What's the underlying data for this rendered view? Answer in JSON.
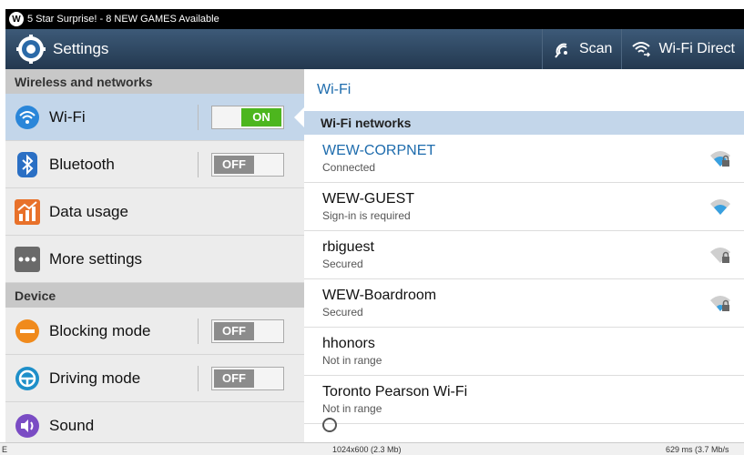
{
  "statusbar": {
    "notification": "5 Star Surprise! - 8 NEW GAMES Available"
  },
  "actionbar": {
    "title": "Settings",
    "scan_label": "Scan",
    "wifi_direct_label": "Wi-Fi Direct"
  },
  "sidebar": {
    "sections": [
      {
        "title": "Wireless and networks",
        "items": [
          {
            "label": "Wi-Fi",
            "icon": "wifi-icon",
            "toggle": "ON",
            "selected": true
          },
          {
            "label": "Bluetooth",
            "icon": "bluetooth-icon",
            "toggle": "OFF"
          },
          {
            "label": "Data usage",
            "icon": "data-usage-icon"
          },
          {
            "label": "More settings",
            "icon": "more-settings-icon"
          }
        ]
      },
      {
        "title": "Device",
        "items": [
          {
            "label": "Blocking mode",
            "icon": "blocking-mode-icon",
            "toggle": "OFF"
          },
          {
            "label": "Driving mode",
            "icon": "driving-mode-icon",
            "toggle": "OFF"
          },
          {
            "label": "Sound",
            "icon": "sound-icon"
          }
        ]
      }
    ]
  },
  "main": {
    "title": "Wi-Fi",
    "networks_header": "Wi-Fi networks",
    "networks": [
      {
        "name": "WEW-CORPNET",
        "status": "Connected",
        "secured": true,
        "connected": true
      },
      {
        "name": "WEW-GUEST",
        "status": "Sign-in is required",
        "secured": false
      },
      {
        "name": "rbiguest",
        "status": "Secured",
        "secured": true
      },
      {
        "name": "WEW-Boardroom",
        "status": "Secured",
        "secured": true
      },
      {
        "name": "hhonors",
        "status": "Not in range"
      },
      {
        "name": "Toronto Pearson Wi-Fi",
        "status": "Not in range"
      }
    ]
  },
  "footer": {
    "left": "E",
    "center": "1024x600 (2.3 Mb)",
    "right": "629 ms (3.7 Mb/s"
  },
  "colors": {
    "accent": "#1e6cad",
    "on": "#4db61e",
    "off": "#8c8c8c",
    "selected": "#c3d6ea",
    "actionbar": "#2e4863"
  }
}
